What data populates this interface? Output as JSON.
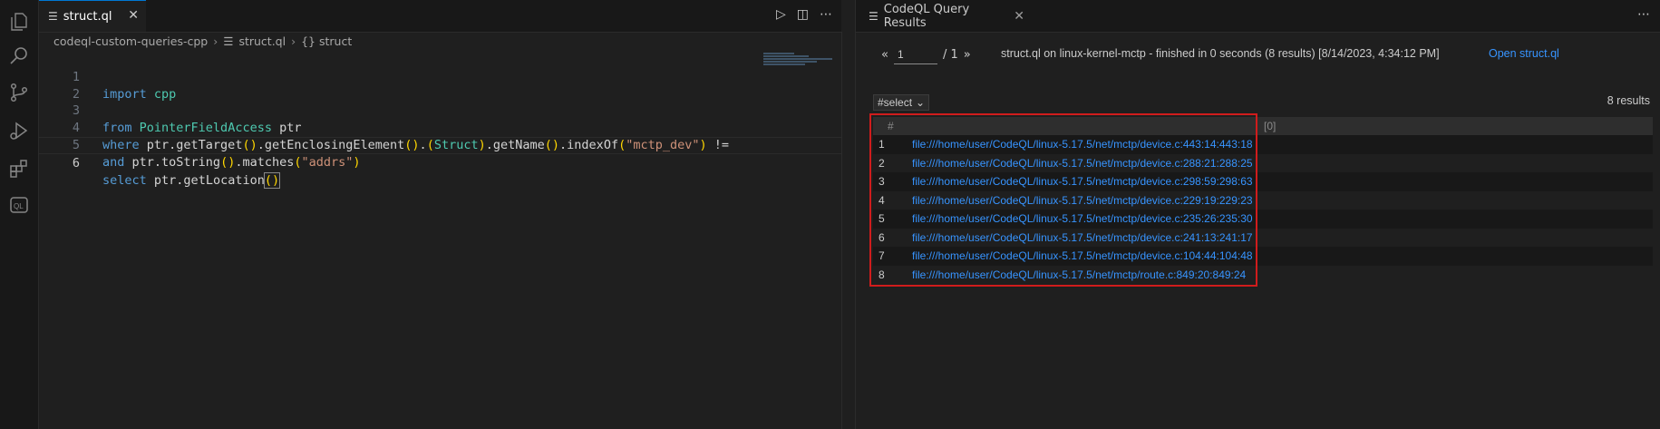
{
  "editor": {
    "tab_label": "struct.ql",
    "breadcrumb": [
      "codeql-custom-queries-cpp",
      "struct.ql",
      "{} struct"
    ],
    "lines": [
      {
        "num": "1",
        "text": "import cpp"
      },
      {
        "num": "2",
        "text": ""
      },
      {
        "num": "3",
        "text": "from PointerFieldAccess ptr"
      },
      {
        "num": "4",
        "text": "where ptr.getTarget().getEnclosingElement().(Struct).getName().indexOf(\"mctp_dev\") !="
      },
      {
        "num": "5",
        "text": "and ptr.toString().matches(\"addrs\")"
      },
      {
        "num": "6",
        "text": "select ptr.getLocation()"
      }
    ]
  },
  "results": {
    "tab_label": "CodeQL Query Results",
    "page_value": "1",
    "page_total": "/ 1",
    "status": "struct.ql on linux-kernel-mctp - finished in 0 seconds (8 results) [8/14/2023, 4:34:12 PM]",
    "open_link": "Open struct.ql",
    "select_value": "#select",
    "count": "8 results",
    "headers": {
      "num": "#",
      "col": "[0]"
    },
    "rows": [
      {
        "num": "1",
        "loc": "file:///home/user/CodeQL/linux-5.17.5/net/mctp/device.c:443:14:443:18"
      },
      {
        "num": "2",
        "loc": "file:///home/user/CodeQL/linux-5.17.5/net/mctp/device.c:288:21:288:25"
      },
      {
        "num": "3",
        "loc": "file:///home/user/CodeQL/linux-5.17.5/net/mctp/device.c:298:59:298:63"
      },
      {
        "num": "4",
        "loc": "file:///home/user/CodeQL/linux-5.17.5/net/mctp/device.c:229:19:229:23"
      },
      {
        "num": "5",
        "loc": "file:///home/user/CodeQL/linux-5.17.5/net/mctp/device.c:235:26:235:30"
      },
      {
        "num": "6",
        "loc": "file:///home/user/CodeQL/linux-5.17.5/net/mctp/device.c:241:13:241:17"
      },
      {
        "num": "7",
        "loc": "file:///home/user/CodeQL/linux-5.17.5/net/mctp/device.c:104:44:104:48"
      },
      {
        "num": "8",
        "loc": "file:///home/user/CodeQL/linux-5.17.5/net/mctp/route.c:849:20:849:24"
      }
    ]
  },
  "icons": [
    "explorer-icon",
    "search-icon",
    "source-control-icon",
    "run-debug-icon",
    "extensions-icon",
    "codeql-icon"
  ],
  "colors": {
    "highlight_border": "#d01c1c",
    "link": "#3794ff",
    "accent": "#0078d4"
  }
}
